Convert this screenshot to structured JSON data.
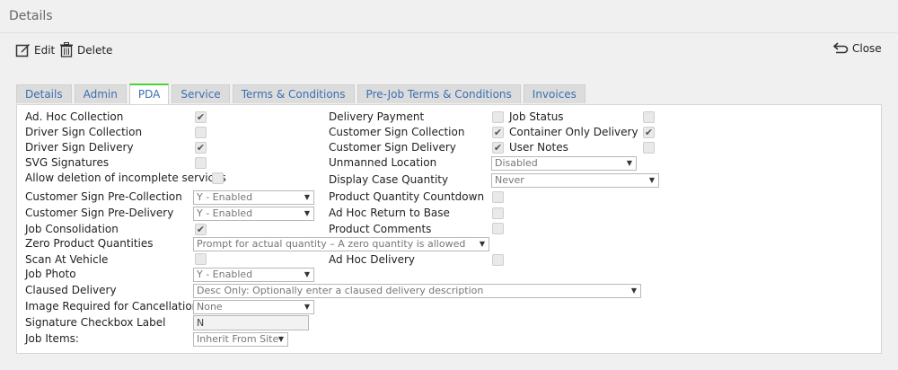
{
  "header": {
    "title": "Details"
  },
  "toolbar": {
    "edit_label": "Edit",
    "delete_label": "Delete",
    "close_label": "Close"
  },
  "tabs": [
    {
      "label": "Details"
    },
    {
      "label": "Admin"
    },
    {
      "label": "PDA"
    },
    {
      "label": "Service"
    },
    {
      "label": "Terms & Conditions"
    },
    {
      "label": "Pre-Job Terms & Conditions"
    },
    {
      "label": "Invoices"
    }
  ],
  "active_tab": "PDA",
  "col1": {
    "ad_hoc_collection": {
      "label": "Ad. Hoc Collection",
      "checked": true
    },
    "driver_sign_collection": {
      "label": "Driver Sign Collection",
      "checked": false
    },
    "driver_sign_delivery": {
      "label": "Driver Sign Delivery",
      "checked": true
    },
    "svg_signatures": {
      "label": "SVG Signatures",
      "checked": false
    },
    "allow_deletion": {
      "label": "Allow deletion of incomplete services",
      "checked": false
    },
    "customer_sign_pre_collection": {
      "label": "Customer Sign Pre-Collection",
      "value": "Y - Enabled"
    },
    "customer_sign_pre_delivery": {
      "label": "Customer Sign Pre-Delivery",
      "value": "Y - Enabled"
    },
    "job_consolidation": {
      "label": "Job Consolidation",
      "checked": true
    },
    "zero_product_quantities": {
      "label": "Zero Product Quantities",
      "value": "Prompt for actual quantity – A zero quantity is allowed"
    },
    "scan_at_vehicle": {
      "label": "Scan At Vehicle",
      "checked": false
    },
    "job_photo": {
      "label": "Job Photo",
      "value": "Y - Enabled"
    },
    "claused_delivery": {
      "label": "Claused Delivery",
      "value": "Desc Only: Optionally enter a claused delivery description"
    },
    "image_required_cancellations": {
      "label": "Image Required for Cancellations",
      "value": "None"
    },
    "signature_checkbox_label": {
      "label": "Signature Checkbox Label",
      "value": "N"
    },
    "job_items": {
      "label": "Job Items:",
      "value": "Inherit From Site"
    }
  },
  "col2": {
    "delivery_payment": {
      "label": "Delivery Payment",
      "checked": false
    },
    "customer_sign_collection": {
      "label": "Customer Sign Collection",
      "checked": true
    },
    "customer_sign_delivery": {
      "label": "Customer Sign Delivery",
      "checked": true
    },
    "unmanned_location": {
      "label": "Unmanned Location",
      "value": "Disabled"
    },
    "display_case_quantity": {
      "label": "Display Case Quantity",
      "value": "Never"
    },
    "product_quantity_countdown": {
      "label": "Product Quantity Countdown",
      "checked": false
    },
    "ad_hoc_return_to_base": {
      "label": "Ad Hoc Return to Base",
      "checked": false
    },
    "product_comments": {
      "label": "Product Comments",
      "checked": false
    },
    "ad_hoc_delivery": {
      "label": "Ad Hoc Delivery",
      "checked": false
    }
  },
  "col3": {
    "job_status": {
      "label": "Job Status",
      "checked": false
    },
    "container_only_delivery": {
      "label": "Container Only Delivery",
      "checked": true
    },
    "user_notes": {
      "label": "User Notes",
      "checked": false
    }
  },
  "icons": {
    "edit": "edit-icon",
    "delete": "trash-icon",
    "close": "return-arrow-icon",
    "checkmark": "checkmark-icon",
    "dropdown": "dropdown-arrow-icon"
  },
  "colors": {
    "tab_text": "#3a6fb0",
    "active_tab_accent": "#4cd137",
    "background": "#f0f0f0"
  }
}
